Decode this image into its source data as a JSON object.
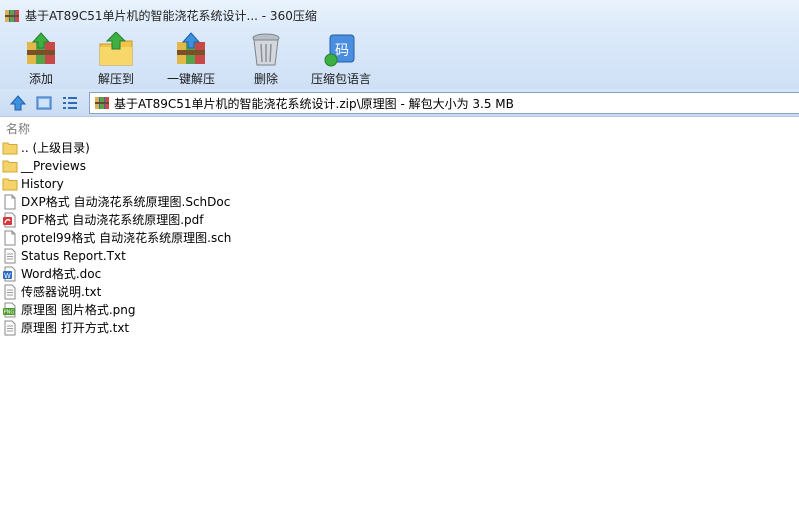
{
  "window": {
    "title": "基于AT89C51单片机的智能浇花系统设计... - 360压缩"
  },
  "toolbar": {
    "add_label": "添加",
    "extract_to_label": "解压到",
    "one_click_extract_label": "一键解压",
    "delete_label": "删除",
    "archive_language_label": "压缩包语言",
    "archive_language_glyph": "码"
  },
  "address": {
    "path": "基于AT89C51单片机的智能浇花系统设计.zip\\原理图 - 解包大小为 3.5 MB"
  },
  "list": {
    "column_name": "名称",
    "items": [
      {
        "name": ".. (上级目录)",
        "icon": "folder-icon"
      },
      {
        "name": "__Previews",
        "icon": "folder-icon"
      },
      {
        "name": "History",
        "icon": "folder-icon"
      },
      {
        "name": "DXP格式 自动浇花系统原理图.SchDoc",
        "icon": "file-icon"
      },
      {
        "name": "PDF格式 自动浇花系统原理图.pdf",
        "icon": "pdf-icon"
      },
      {
        "name": "protel99格式 自动浇花系统原理图.sch",
        "icon": "file-icon"
      },
      {
        "name": "Status Report.Txt",
        "icon": "text-file-icon"
      },
      {
        "name": "Word格式.doc",
        "icon": "word-icon"
      },
      {
        "name": "传感器说明.txt",
        "icon": "text-file-icon"
      },
      {
        "name": "原理图  图片格式.png",
        "icon": "image-icon"
      },
      {
        "name": "原理图 打开方式.txt",
        "icon": "text-file-icon"
      }
    ]
  },
  "colors": {
    "titlebar_bg": "#e1eefc",
    "toolbar_bg": "#d5e5f8",
    "folder": "#f5d36b",
    "pdf_red": "#d9363e",
    "word_blue": "#2b6cc4",
    "png_green": "#4c9a2a"
  }
}
